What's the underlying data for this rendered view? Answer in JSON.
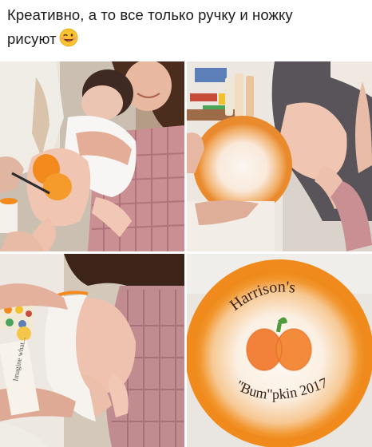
{
  "post": {
    "caption_line1": "Креативно, а то все только ручку и ножку",
    "caption_line2": "рисуют",
    "emoji": "winking-face-tongue"
  },
  "photos": [
    {
      "name": "photo-painting-baby",
      "position": "top-left"
    },
    {
      "name": "photo-bowl-inside",
      "position": "top-right"
    },
    {
      "name": "photo-stamping-bowl",
      "position": "bottom-left"
    },
    {
      "name": "photo-finished-bowl",
      "position": "bottom-right"
    }
  ],
  "bowl": {
    "line1": "Harrison's",
    "line2": "\"Bum\"pkin 2017",
    "colors": {
      "orange": "#f28a1e",
      "pumpkin": "#f2823a",
      "stem": "#4f9a3a",
      "ink": "#3a2418"
    }
  }
}
